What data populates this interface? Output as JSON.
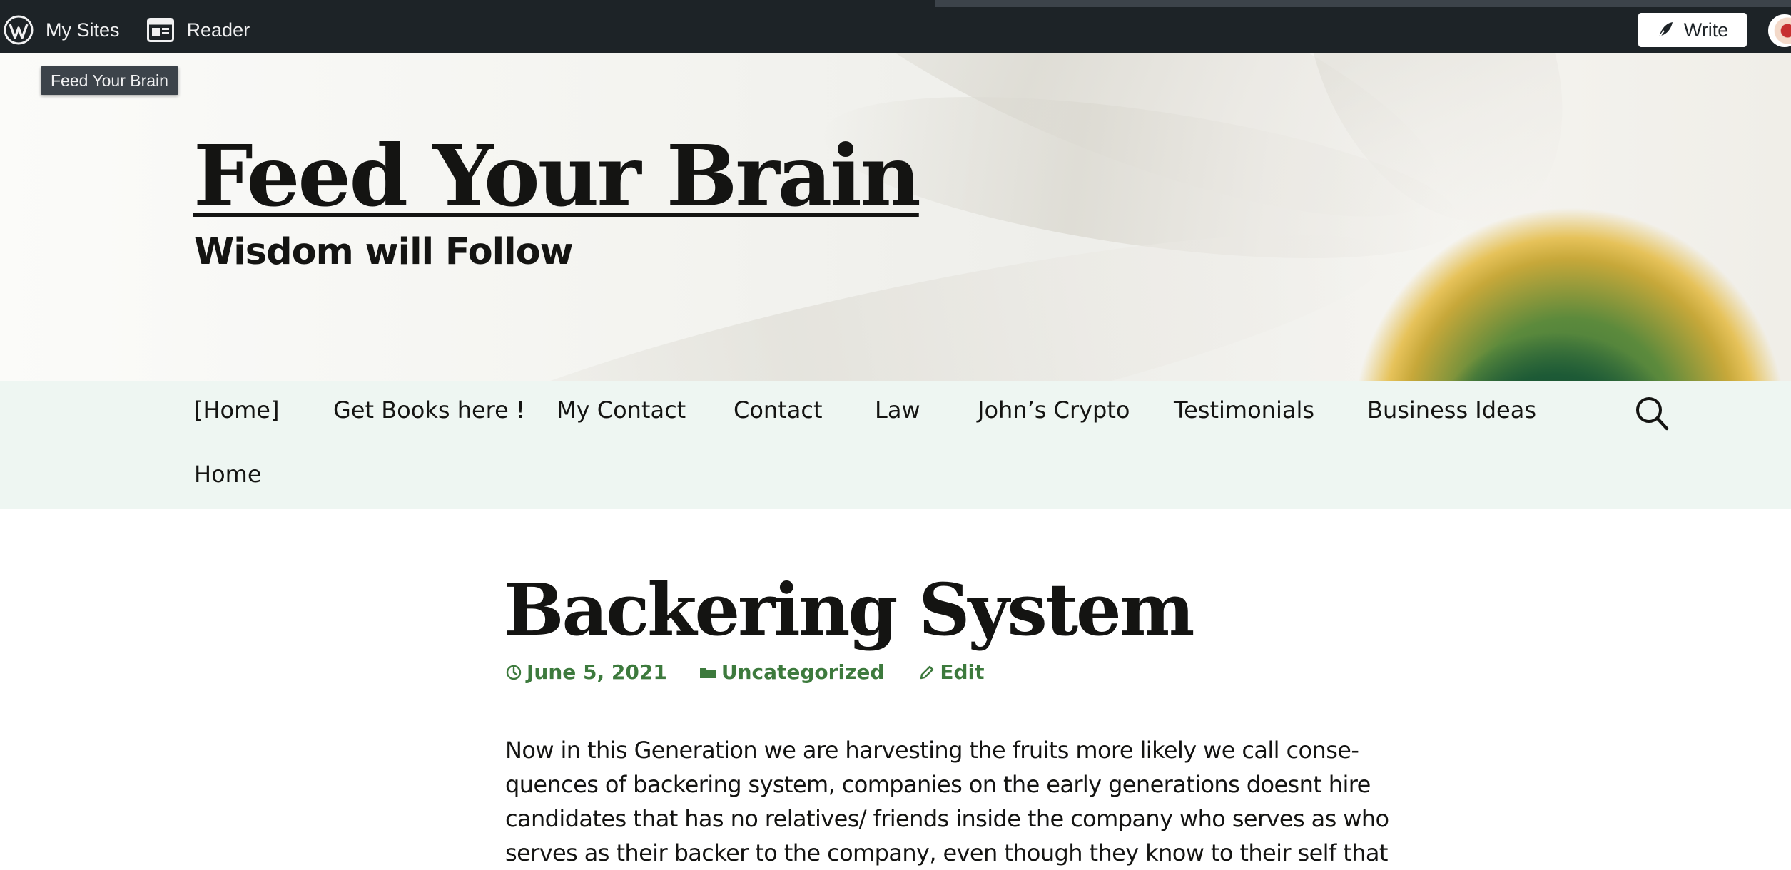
{
  "adminbar": {
    "my_sites_label": "My Sites",
    "reader_label": "Reader",
    "write_label": "Write",
    "wordpress_icon": "wordpress-logo-icon",
    "reader_icon": "reader-icon",
    "write_icon": "quill-icon",
    "colors": {
      "background": "#1d2327",
      "text": "#f0f0f1"
    }
  },
  "tooltip": {
    "text": "Feed Your Brain"
  },
  "header": {
    "site_title": "Feed Your Brain",
    "tagline": "Wisdom will Follow"
  },
  "nav": {
    "items": [
      {
        "label": "[Home]"
      },
      {
        "label": "Get Books here !"
      },
      {
        "label": "My Contact"
      },
      {
        "label": "Contact"
      },
      {
        "label": "Law"
      },
      {
        "label": "John’s Crypto"
      },
      {
        "label": "Testimonials"
      },
      {
        "label": "Business Ideas"
      },
      {
        "label": "Home"
      }
    ],
    "search_icon": "search-icon",
    "background": "#eef6f2"
  },
  "post": {
    "title": "Backering System",
    "date": "June 5, 2021",
    "category": "Uncategorized",
    "edit_label": "Edit",
    "meta_color": "#3d7a3d",
    "content_lines": [
      "Now in this Generation we are harvesting the fruits more likely we call conse-",
      "quences of backering system, companies on the early generations doesnt hire",
      "candidates that has no relatives/ friends inside the company who serves as who",
      "serves as their backer to the company, even though they know to their self that"
    ]
  }
}
